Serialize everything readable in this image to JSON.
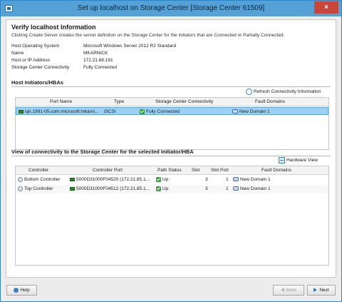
{
  "window": {
    "title": "Set up localhost on Storage Center [Storage Center 61509]",
    "close_glyph": "×"
  },
  "header": {
    "heading": "Verify localhost Information",
    "description": "Clicking Create Server creates the server definition on the Storage Center for the initiators that are Connected or Partially Connected."
  },
  "info": [
    {
      "label": "Host Operating System",
      "value": "Microsoft Windows Server 2012 R2 Standard"
    },
    {
      "label": "Name",
      "value": "MKARNICK"
    },
    {
      "label": "Host or IP Address",
      "value": "172.21.68.181"
    },
    {
      "label": "Storage Center Connectivity",
      "value": "Fully Connected"
    }
  ],
  "initiators": {
    "title": "Host Initiators/HBAs",
    "refresh_label": "Refresh Connectivity Information",
    "columns": [
      "Port Name",
      "Type",
      "Storage Center Connectivity",
      "Fault Domains"
    ],
    "rows": [
      {
        "port": "iqn.1991-05.com.microsoft:mkarni...",
        "type": "iSCSI",
        "connectivity": "Fully Connected",
        "domain": "New Domain 1"
      }
    ]
  },
  "connectivity": {
    "title": "View of connectivity to the Storage Center for the selected Initiator/HBA",
    "hardware_label": "Hardware View",
    "columns": [
      "Controller",
      "Controller Port",
      "Path Status",
      "Slot",
      "Slot Port",
      "Fault Domains"
    ],
    "rows": [
      {
        "controller": "Bottom Controller",
        "port": "5000D31000F04520 (172.21.85.1...",
        "status": "Up",
        "slot": "3",
        "slot_port": "1",
        "domain": "New Domain 1"
      },
      {
        "controller": "Top Controller",
        "port": "5000D31000F04512 (172.21.85.1...",
        "status": "Up",
        "slot": "3",
        "slot_port": "1",
        "domain": "New Domain 1"
      }
    ]
  },
  "footer": {
    "help": "Help",
    "back": "Back",
    "next": "Next"
  },
  "colors": {
    "titlebar": "#55a1d6",
    "selection": "#9fd0f3",
    "status_ok": "#3aa13a"
  }
}
